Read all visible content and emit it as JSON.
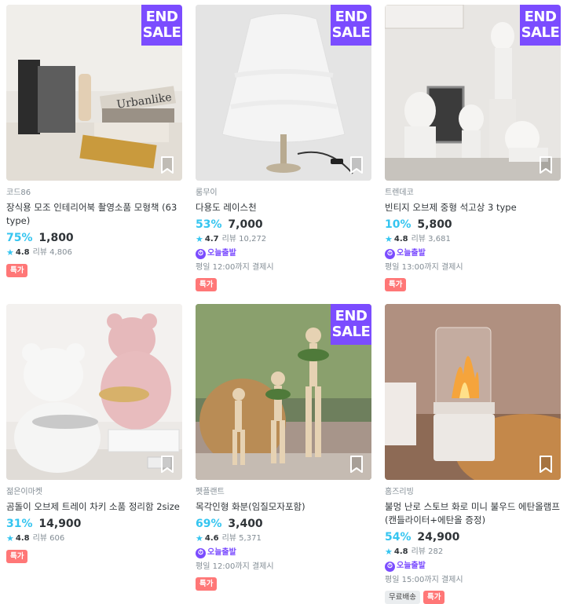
{
  "products": [
    {
      "badge_top": "END",
      "badge_bottom": "SALE",
      "brand": "코드86",
      "name": "장식용 모조 인테리어북 촬영소품 모형책 (63 type)",
      "discount": "75%",
      "price": "1,800",
      "rating": "4.8",
      "review": "리뷰 4,806",
      "tag": "특가"
    },
    {
      "badge_top": "END",
      "badge_bottom": "SALE",
      "brand": "룸무이",
      "name": "다용도 레이스천",
      "discount": "53%",
      "price": "7,000",
      "rating": "4.7",
      "review": "리뷰 10,272",
      "departure": "오늘출발",
      "pay_note": "평일 12:00까지 결제시",
      "tag": "특가"
    },
    {
      "badge_top": "END",
      "badge_bottom": "SALE",
      "brand": "트렌데코",
      "name": "빈티지 오브제 중형 석고상 3 type",
      "discount": "10%",
      "price": "5,800",
      "rating": "4.8",
      "review": "리뷰 3,681",
      "departure": "오늘출발",
      "pay_note": "평일 13:00까지 결제시",
      "tag": "특가"
    },
    {
      "brand": "젊은이마켓",
      "name": "곰돌이 오브제 트레이 차키 소품 정리함 2size",
      "discount": "31%",
      "price": "14,900",
      "rating": "4.8",
      "review": "리뷰 606",
      "tag": "특가"
    },
    {
      "badge_top": "END",
      "badge_bottom": "SALE",
      "brand": "펫플랜트",
      "name": "목각인형 화분(임질모자포함)",
      "discount": "69%",
      "price": "3,400",
      "rating": "4.6",
      "review": "리뷰 5,371",
      "departure": "오늘출발",
      "pay_note": "평일 12:00까지 결제시",
      "tag": "특가"
    },
    {
      "brand": "홈즈리빙",
      "name": "불멍 난로 스토브 화로 미니 불우드 에탄올램프 (캔들라이터+에탄올 증정)",
      "discount": "54%",
      "price": "24,900",
      "rating": "4.8",
      "review": "리뷰 282",
      "departure": "오늘출발",
      "pay_note": "평일 15:00까지 결제시",
      "tag_free": "무료배송",
      "tag": "특가"
    }
  ],
  "colors": {
    "accent": "#35c5f0",
    "badge": "#7b4cff",
    "tag": "#ff7777"
  },
  "icons": {
    "bookmark": "bookmark-icon",
    "star": "star-icon",
    "departure": "departure-icon"
  }
}
